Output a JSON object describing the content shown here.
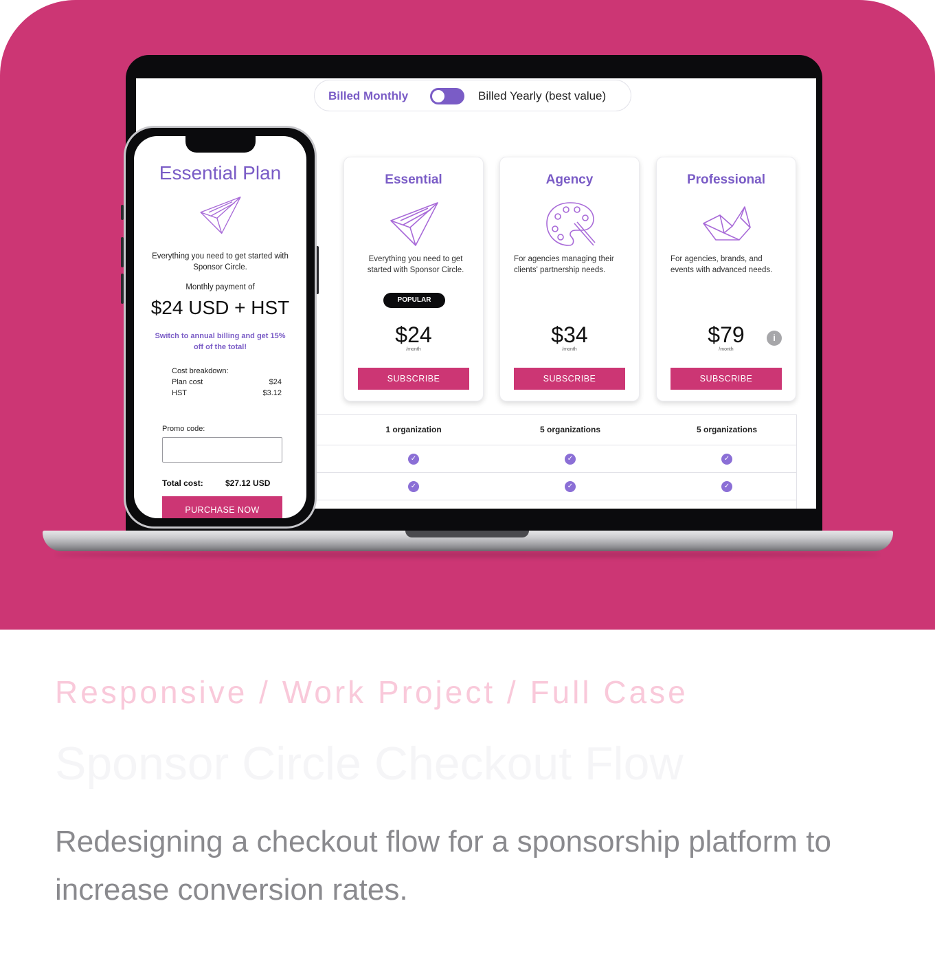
{
  "colors": {
    "hero_bg": "#cc3674",
    "accent_purple": "#7a5cc6",
    "button_pink": "#cc3674"
  },
  "billing_toggle": {
    "left_label": "Billed Monthly",
    "right_label": "Billed Yearly (best value)"
  },
  "plans": [
    {
      "title": "Essential",
      "description": "Everything you need to get started with Sponsor Circle.",
      "badge": "POPULAR",
      "price": "$24",
      "period": "/month",
      "button": "SUBSCRIBE",
      "icon": "paper-plane-icon"
    },
    {
      "title": "Agency",
      "description": "For agencies managing their clients' partnership needs.",
      "price": "$34",
      "period": "/month",
      "button": "SUBSCRIBE",
      "icon": "palette-icon"
    },
    {
      "title": "Professional",
      "description": "For agencies, brands, and events with advanced needs.",
      "price": "$79",
      "period": "/month",
      "button": "SUBSCRIBE",
      "icon": "origami-bird-icon",
      "info": "i"
    }
  ],
  "features": {
    "organizations": [
      "1 organization",
      "5 organizations",
      "5 organizations"
    ]
  },
  "mobile": {
    "title": "Essential Plan",
    "description": "Everything you need to get started with Sponsor Circle.",
    "monthly_label": "Monthly payment of",
    "price": "$24 USD + HST",
    "annual_note": "Switch to annual billing and get 15% off of the total!",
    "breakdown_title": "Cost breakdown:",
    "breakdown": [
      {
        "label": "Plan cost",
        "value": "$24"
      },
      {
        "label": "HST",
        "value": "$3.12"
      }
    ],
    "promo_label": "Promo code:",
    "promo_value": "",
    "total_label": "Total cost:",
    "total_value": "$27.12 USD",
    "purchase_button": "PURCHASE NOW"
  },
  "caption": {
    "tags": "Responsive / Work Project / Full Case",
    "title": "Sponsor Circle Checkout Flow",
    "summary": "Redesigning a checkout flow for a sponsorship platform to increase conversion rates."
  }
}
